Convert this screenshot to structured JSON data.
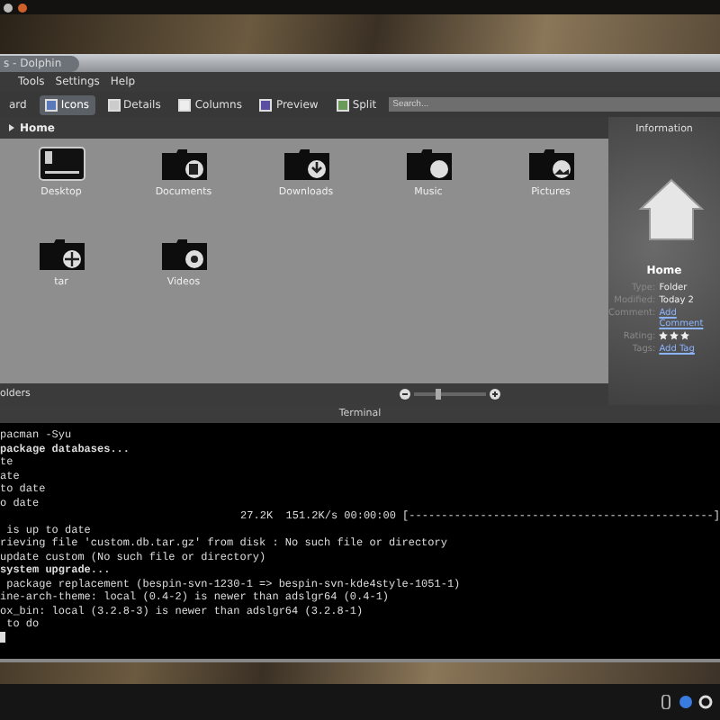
{
  "window": {
    "title": "s - Dolphin"
  },
  "menu": [
    "Tools",
    "Settings",
    "Help"
  ],
  "toolbar": [
    {
      "label": "ard",
      "kind": "plain",
      "selected": false
    },
    {
      "label": "Icons",
      "kind": "icons",
      "selected": true
    },
    {
      "label": "Details",
      "kind": "details",
      "selected": false
    },
    {
      "label": "Columns",
      "kind": "columns",
      "selected": false
    },
    {
      "label": "Preview",
      "kind": "preview",
      "selected": false
    },
    {
      "label": "Split",
      "kind": "split",
      "selected": false
    }
  ],
  "search": {
    "placeholder": "Search..."
  },
  "breadcrumb": "Home",
  "files": [
    {
      "name": "Desktop",
      "kind": "desktop"
    },
    {
      "name": "Documents",
      "kind": "documents"
    },
    {
      "name": "Downloads",
      "kind": "downloads"
    },
    {
      "name": "Music",
      "kind": "music"
    },
    {
      "name": "Pictures",
      "kind": "pictures"
    },
    {
      "name": "tar",
      "kind": "archive"
    },
    {
      "name": "Videos",
      "kind": "videos"
    }
  ],
  "status": {
    "text": "olders",
    "zoom": {
      "level": 0.3
    }
  },
  "information": {
    "title": "Information",
    "name": "Home",
    "fields": [
      {
        "label": "Type:",
        "value": "Folder",
        "kind": "text"
      },
      {
        "label": "Modified:",
        "value": "Today 2",
        "kind": "text"
      },
      {
        "label": "Comment:",
        "value": "Add Comment",
        "kind": "link"
      },
      {
        "label": "Rating:",
        "stars": 3,
        "kind": "rating"
      },
      {
        "label": "Tags:",
        "value": "Add Tag",
        "kind": "link"
      }
    ]
  },
  "terminal": {
    "title": "Terminal",
    "lines": [
      {
        "text": "pacman -Syu",
        "kind": "plain"
      },
      {
        "text": "package databases...",
        "kind": "bold"
      },
      {
        "text": "te",
        "kind": "plain"
      },
      {
        "text": "ate",
        "kind": "plain"
      },
      {
        "text": "to date",
        "kind": "plain"
      },
      {
        "text": "o date",
        "kind": "plain"
      },
      {
        "text": "27.2K  151.2K/s 00:00:00 [-----------------------------------------------]",
        "kind": "progress"
      },
      {
        "text": " is up to date",
        "kind": "plain"
      },
      {
        "text": "rieving file 'custom.db.tar.gz' from disk : No such file or directory",
        "kind": "plain"
      },
      {
        "text": "update custom (No such file or directory)",
        "kind": "plain"
      },
      {
        "text": "system upgrade...",
        "kind": "bold"
      },
      {
        "text": " package replacement (bespin-svn-1230-1 => bespin-svn-kde4style-1051-1)",
        "kind": "plain"
      },
      {
        "text": "ine-arch-theme: local (0.4-2) is newer than adslgr64 (0.4-1)",
        "kind": "plain"
      },
      {
        "text": "ox_bin: local (3.2.8-3) is newer than adslgr64 (3.2.8-1)",
        "kind": "plain"
      },
      {
        "text": " to do",
        "kind": "plain"
      }
    ]
  }
}
